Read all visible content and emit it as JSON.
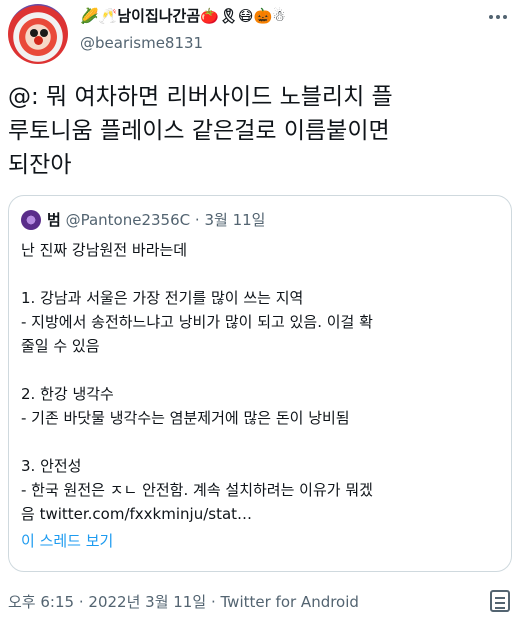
{
  "author": {
    "name": "🌽🥂남이집나간곰🍅🎗😷🎃☃",
    "handle": "@bearisme8131"
  },
  "tweet": {
    "lines": [
      "@: 뭐 여차하면 리버사이드 노블리치 플",
      "루토니움 플레이스 같은걸로 이름붙이면",
      "되잔아"
    ]
  },
  "quote": {
    "name": "범",
    "handle": "@Pantone2356C",
    "separator": "·",
    "date": "3월 11일",
    "lines": [
      "난 진짜 강남원전 바라는데",
      "",
      "1. 강남과 서울은 가장 전기를 많이 쓰는 지역",
      " - 지방에서 송전하느냐고 낭비가 많이 되고 있음. 이걸 확",
      "줄일 수 있음",
      "",
      "2. 한강 냉각수",
      " - 기존 바닷물 냉각수는 염분제거에 많은 돈이 낭비됨",
      "",
      "3. 안전성",
      " - 한국 원전은 ㅈㄴ 안전함. 계속  설치하려는 이유가 뭐겠",
      "음 twitter.com/fxxkminju/stat…"
    ],
    "thread_link": "이 스레드 보기"
  },
  "footer": {
    "time": "오후 6:15",
    "separator": "·",
    "date": "2022년 3월 11일",
    "source": "Twitter for Android"
  }
}
